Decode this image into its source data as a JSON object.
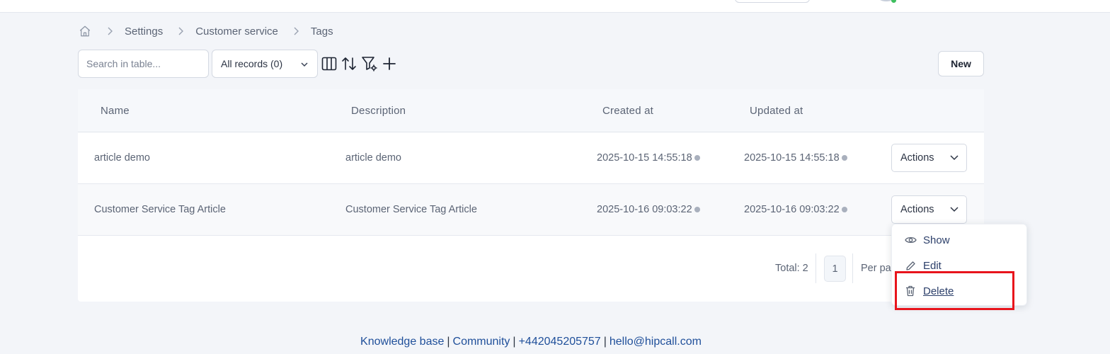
{
  "breadcrumb": {
    "items": [
      "Settings",
      "Customer service",
      "Tags"
    ]
  },
  "toolbar": {
    "search_placeholder": "Search in table...",
    "filter_select": "All records (0)",
    "new_label": "New"
  },
  "table": {
    "columns": [
      "Name",
      "Description",
      "Created at",
      "Updated at"
    ],
    "rows": [
      {
        "name": "article demo",
        "description": "article demo",
        "created_at": "2025-10-15 14:55:18",
        "updated_at": "2025-10-15 14:55:18",
        "actions_label": "Actions"
      },
      {
        "name": "Customer Service Tag Article",
        "description": "Customer Service Tag Article",
        "created_at": "2025-10-16 09:03:22",
        "updated_at": "2025-10-16 09:03:22",
        "actions_label": "Actions"
      }
    ]
  },
  "pagination": {
    "total": "Total: 2",
    "current_page": "1",
    "per_page_label": "Per pa"
  },
  "actions_menu": {
    "items": [
      {
        "label": "Show",
        "icon": "eye-icon"
      },
      {
        "label": "Edit",
        "icon": "pencil-icon"
      },
      {
        "label": "Delete",
        "icon": "trash-icon"
      }
    ]
  },
  "footer": {
    "knowledge_base": "Knowledge base",
    "community": "Community",
    "phone": "+442045205757",
    "email": "hello@hipcall.com",
    "separator": "|"
  },
  "colors": {
    "background": "#f3f5f9",
    "link": "#1f4f9a",
    "highlight": "#e8141c"
  }
}
